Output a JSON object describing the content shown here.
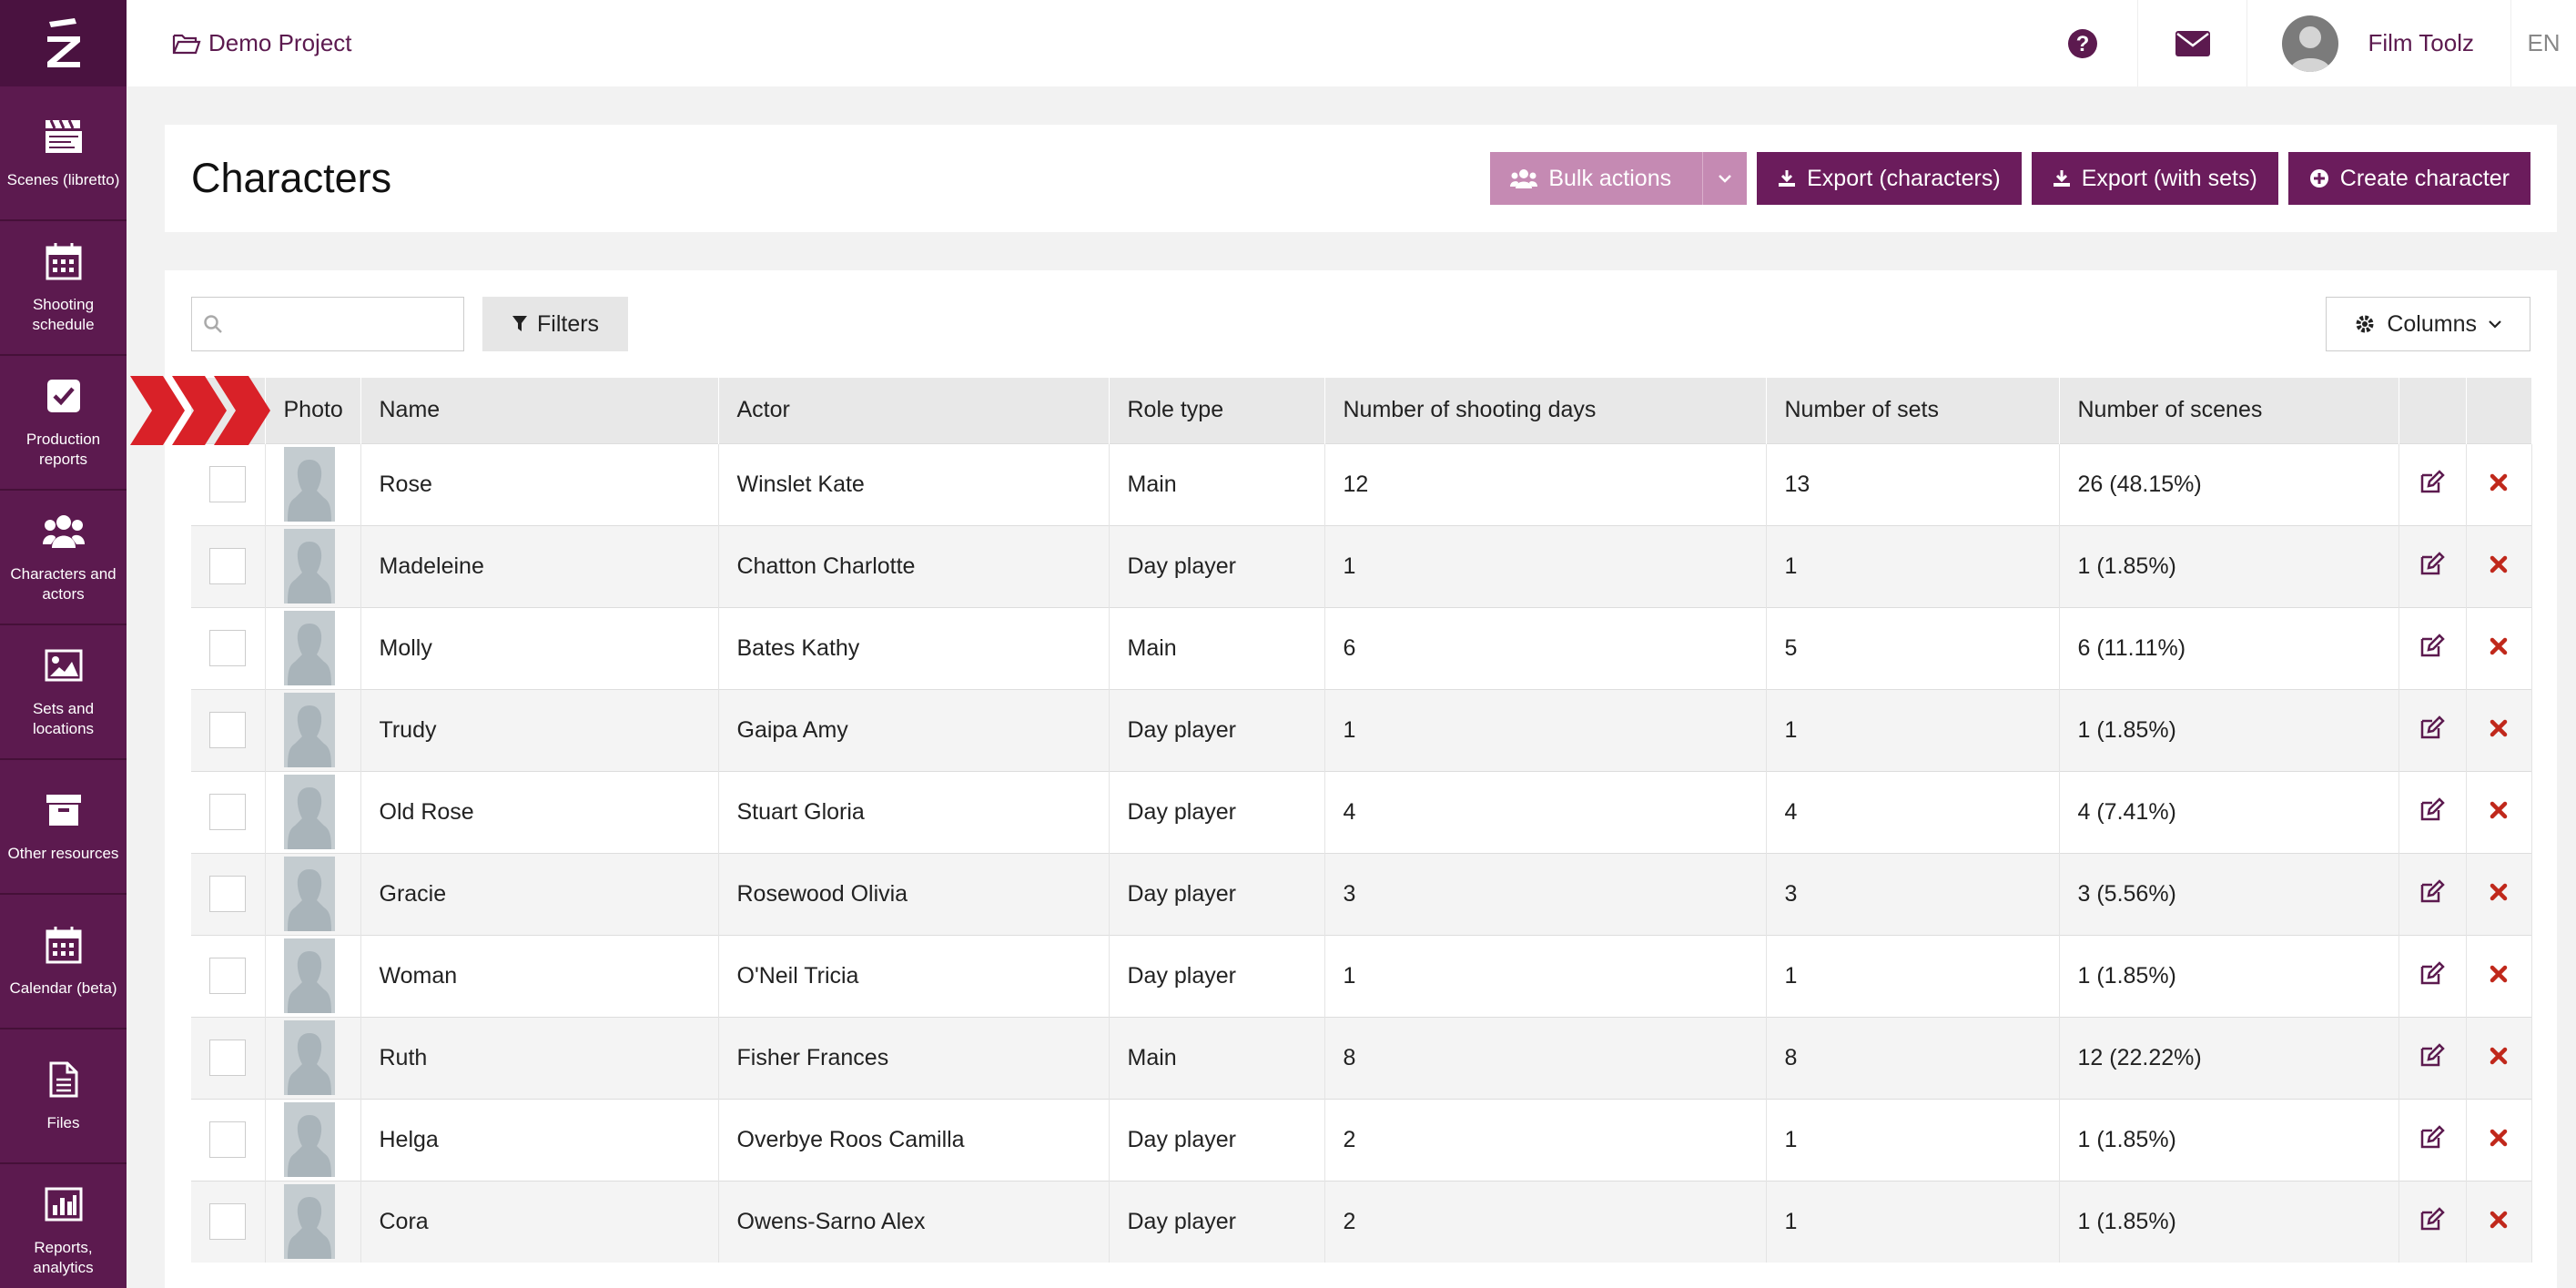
{
  "sidebar": {
    "items": [
      {
        "label": "Scenes (libretto)",
        "icon": "clapperboard-icon"
      },
      {
        "label": "Shooting schedule",
        "icon": "calendar-icon"
      },
      {
        "label": "Production reports",
        "icon": "check-square-icon"
      },
      {
        "label": "Characters and actors",
        "icon": "users-icon"
      },
      {
        "label": "Sets and locations",
        "icon": "image-icon"
      },
      {
        "label": "Other resources",
        "icon": "archive-icon"
      },
      {
        "label": "Calendar (beta)",
        "icon": "calendar-icon"
      },
      {
        "label": "Files",
        "icon": "file-icon"
      },
      {
        "label": "Reports, analytics",
        "icon": "bar-chart-icon"
      }
    ]
  },
  "topbar": {
    "project": "Demo Project",
    "user": "Film Toolz",
    "lang": "EN"
  },
  "header": {
    "title": "Characters",
    "bulk": "Bulk actions",
    "export_chars": "Export (characters)",
    "export_sets": "Export (with sets)",
    "create": "Create character"
  },
  "toolbar": {
    "search_value": "",
    "filters": "Filters",
    "columns": "Columns"
  },
  "table": {
    "headers": [
      "Photo",
      "Name",
      "Actor",
      "Role type",
      "Number of shooting days",
      "Number of sets",
      "Number of scenes"
    ],
    "rows": [
      {
        "name": "Rose",
        "actor": "Winslet Kate",
        "role": "Main",
        "days": "12",
        "sets": "13",
        "scenes": "26 (48.15%)"
      },
      {
        "name": "Madeleine",
        "actor": "Chatton Charlotte",
        "role": "Day player",
        "days": "1",
        "sets": "1",
        "scenes": "1 (1.85%)"
      },
      {
        "name": "Molly",
        "actor": "Bates Kathy",
        "role": "Main",
        "days": "6",
        "sets": "5",
        "scenes": "6 (11.11%)"
      },
      {
        "name": "Trudy",
        "actor": "Gaipa Amy",
        "role": "Day player",
        "days": "1",
        "sets": "1",
        "scenes": "1 (1.85%)"
      },
      {
        "name": "Old Rose",
        "actor": "Stuart Gloria",
        "role": "Day player",
        "days": "4",
        "sets": "4",
        "scenes": "4 (7.41%)"
      },
      {
        "name": "Gracie",
        "actor": "Rosewood Olivia",
        "role": "Day player",
        "days": "3",
        "sets": "3",
        "scenes": "3 (5.56%)"
      },
      {
        "name": "Woman",
        "actor": "O'Neil Tricia",
        "role": "Day player",
        "days": "1",
        "sets": "1",
        "scenes": "1 (1.85%)"
      },
      {
        "name": "Ruth",
        "actor": "Fisher Frances",
        "role": "Main",
        "days": "8",
        "sets": "8",
        "scenes": "12 (22.22%)"
      },
      {
        "name": "Helga",
        "actor": "Overbye Roos Camilla",
        "role": "Day player",
        "days": "2",
        "sets": "1",
        "scenes": "1 (1.85%)"
      },
      {
        "name": "Cora",
        "actor": "Owens-Sarno Alex",
        "role": "Day player",
        "days": "2",
        "sets": "1",
        "scenes": "1 (1.85%)"
      }
    ]
  },
  "colors": {
    "brand": "#5c1a4f",
    "button": "#6b1c5c",
    "bulk": "#c58ab3",
    "delete": "#c0281b",
    "ribbon": "#d92128"
  }
}
